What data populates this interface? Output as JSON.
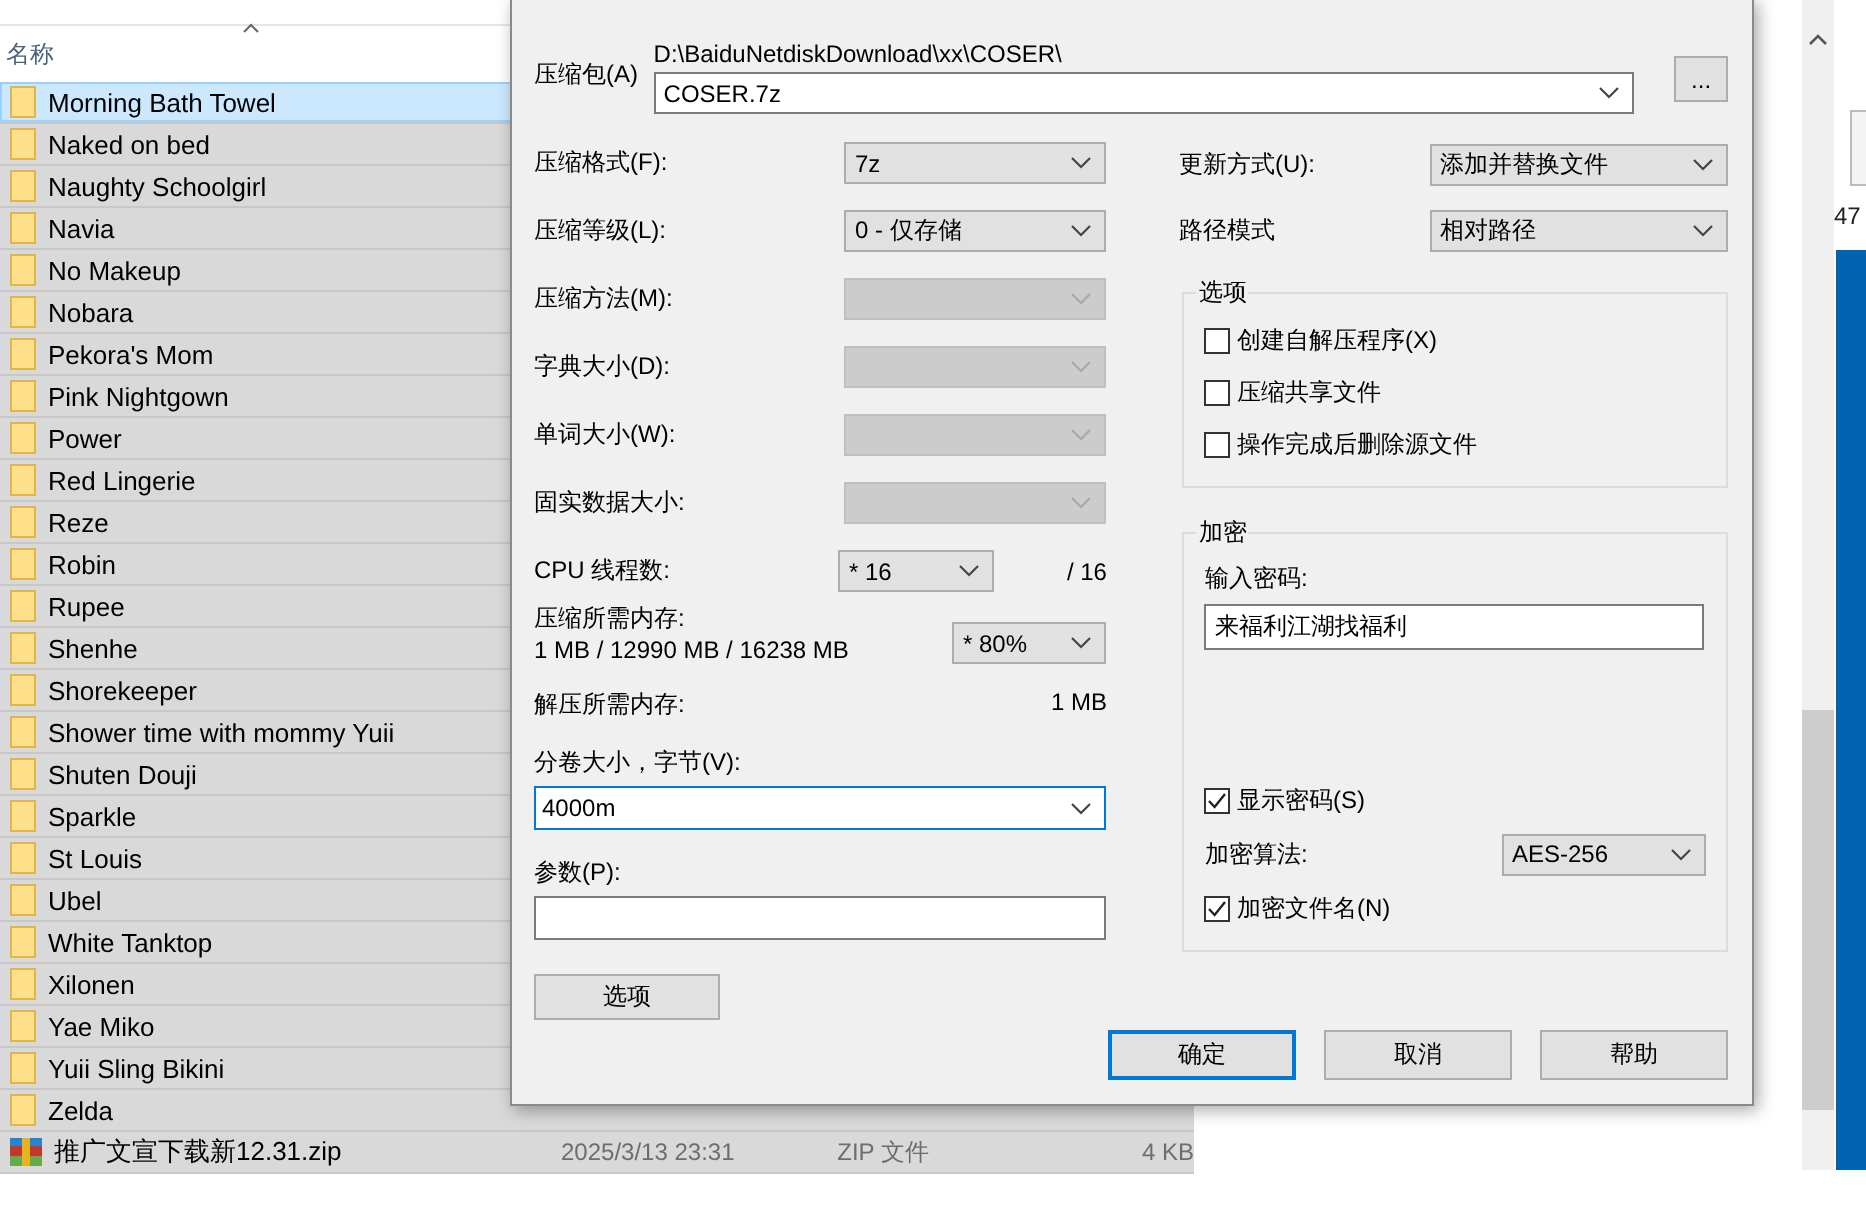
{
  "explorer": {
    "header": "名称",
    "rows": [
      {
        "name": "Morning Bath Towel",
        "kind": "folder",
        "selected": true
      },
      {
        "name": "Naked on bed",
        "kind": "folder",
        "selected": false
      },
      {
        "name": "Naughty Schoolgirl",
        "kind": "folder",
        "selected": false
      },
      {
        "name": "Navia",
        "kind": "folder",
        "selected": false
      },
      {
        "name": "No Makeup",
        "kind": "folder",
        "selected": false
      },
      {
        "name": "Nobara",
        "kind": "folder",
        "selected": false
      },
      {
        "name": "Pekora's Mom",
        "kind": "folder",
        "selected": false
      },
      {
        "name": "Pink Nightgown",
        "kind": "folder",
        "selected": false
      },
      {
        "name": "Power",
        "kind": "folder",
        "selected": false
      },
      {
        "name": "Red Lingerie",
        "kind": "folder",
        "selected": false
      },
      {
        "name": "Reze",
        "kind": "folder",
        "selected": false
      },
      {
        "name": "Robin",
        "kind": "folder",
        "selected": false
      },
      {
        "name": "Rupee",
        "kind": "folder",
        "selected": false
      },
      {
        "name": "Shenhe",
        "kind": "folder",
        "selected": false
      },
      {
        "name": "Shorekeeper",
        "kind": "folder",
        "selected": false
      },
      {
        "name": "Shower time with mommy Yuii",
        "kind": "folder",
        "selected": false
      },
      {
        "name": "Shuten Douji",
        "kind": "folder",
        "selected": false
      },
      {
        "name": "Sparkle",
        "kind": "folder",
        "selected": false
      },
      {
        "name": "St Louis",
        "kind": "folder",
        "selected": false
      },
      {
        "name": "Ubel",
        "kind": "folder",
        "selected": false
      },
      {
        "name": "White Tanktop",
        "kind": "folder",
        "selected": false
      },
      {
        "name": "Xilonen",
        "kind": "folder",
        "selected": false
      },
      {
        "name": "Yae Miko",
        "kind": "folder",
        "selected": false
      },
      {
        "name": "Yuii Sling Bikini",
        "kind": "folder",
        "selected": false
      },
      {
        "name": "Zelda",
        "kind": "folder",
        "selected": false
      },
      {
        "name": "推广文宣下载新12.31.zip",
        "kind": "zip",
        "selected": false,
        "date": "2025/3/13 23:31",
        "type": "ZIP 文件",
        "size": "4 KB"
      }
    ]
  },
  "desktop": {
    "label": "47"
  },
  "dialog": {
    "archive": {
      "label": "压缩包(A)",
      "path": "D:\\BaiduNetdiskDownload\\xx\\COSER\\",
      "value": "COSER.7z",
      "browse": "..."
    },
    "left": [
      {
        "kind": "combo",
        "label": "压缩格式(F):",
        "value": "7z",
        "disabled": false
      },
      {
        "kind": "combo",
        "label": "压缩等级(L):",
        "value": "0 - 仅存储",
        "disabled": false
      },
      {
        "kind": "combo",
        "label": "压缩方法(M):",
        "disabled": true
      },
      {
        "kind": "combo",
        "label": "字典大小(D):",
        "disabled": true
      },
      {
        "kind": "combo",
        "label": "单词大小(W):",
        "disabled": true
      },
      {
        "kind": "combo",
        "label": "固实数据大小:",
        "disabled": true
      },
      {
        "kind": "cpu",
        "label": "CPU 线程数:",
        "value": "* 16",
        "total": "/ 16"
      },
      {
        "kind": "memory",
        "label": "压缩所需内存:",
        "detail": "1 MB / 12990 MB / 16238 MB",
        "value": "* 80%"
      },
      {
        "kind": "info",
        "label": "解压所需内存:",
        "value": "1 MB"
      },
      {
        "kind": "input",
        "label": "分卷大小，字节(V):",
        "value": "4000m",
        "dropdown": true,
        "focused": true
      },
      {
        "kind": "input",
        "label": "参数(P):",
        "dropdown": false,
        "focused": false
      }
    ],
    "options_button": "选项",
    "right": [
      {
        "label": "更新方式(U):",
        "value": "添加并替换文件"
      },
      {
        "label": "路径模式",
        "value": "相对路径"
      }
    ],
    "options": {
      "title": "选项",
      "items": [
        {
          "label": "创建自解压程序(X)",
          "checked": false
        },
        {
          "label": "压缩共享文件",
          "checked": false
        },
        {
          "label": "操作完成后删除源文件",
          "checked": false
        }
      ]
    },
    "encryption": {
      "title": "加密",
      "password_label": "输入密码:",
      "password": "来福利江湖找福利",
      "show_password": {
        "label": "显示密码(S)",
        "checked": true
      },
      "method_label": "加密算法:",
      "method": "AES-256",
      "encrypt_names": {
        "label": "加密文件名(N)",
        "checked": true
      }
    },
    "buttons": [
      {
        "label": "确定",
        "default": true
      },
      {
        "label": "取消",
        "default": false
      },
      {
        "label": "帮助",
        "default": false
      }
    ]
  }
}
